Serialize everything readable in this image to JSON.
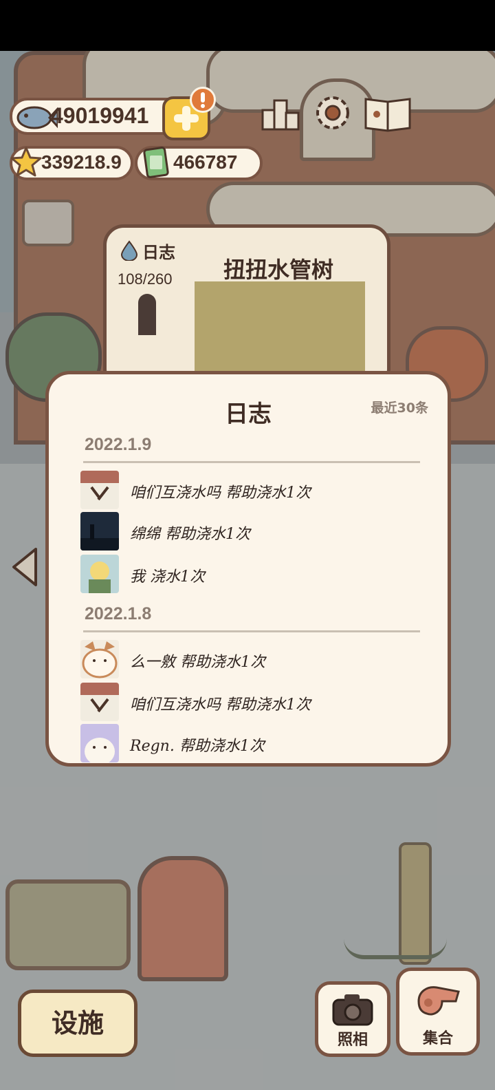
{
  "currency": {
    "fish": "49019941",
    "stars": "339218.9",
    "cash": "466787"
  },
  "background_card": {
    "journal_label": "日志",
    "progress": "108/260",
    "tree_name": "扭扭水管树"
  },
  "log_modal": {
    "title": "日志",
    "recent_label": "最近30条",
    "groups": [
      {
        "date": "2022.1.9",
        "entries": [
          {
            "text": "咱们互浇水吗 帮助浇水1次"
          },
          {
            "text": "绵绵 帮助浇水1次"
          },
          {
            "text": "我 浇水1次"
          }
        ]
      },
      {
        "date": "2022.1.8",
        "entries": [
          {
            "text": "么一敫 帮助浇水1次"
          },
          {
            "text": "咱们互浇水吗 帮助浇水1次"
          },
          {
            "text": "Regn. 帮助浇水1次"
          }
        ]
      }
    ]
  },
  "buttons": {
    "facilities": "设施",
    "photo": "照相",
    "gather": "集合"
  },
  "colors": {
    "panel": "#fcf5ea",
    "border": "#7a5443",
    "accent_yellow": "#f4c542",
    "notification": "#e07a3a"
  }
}
